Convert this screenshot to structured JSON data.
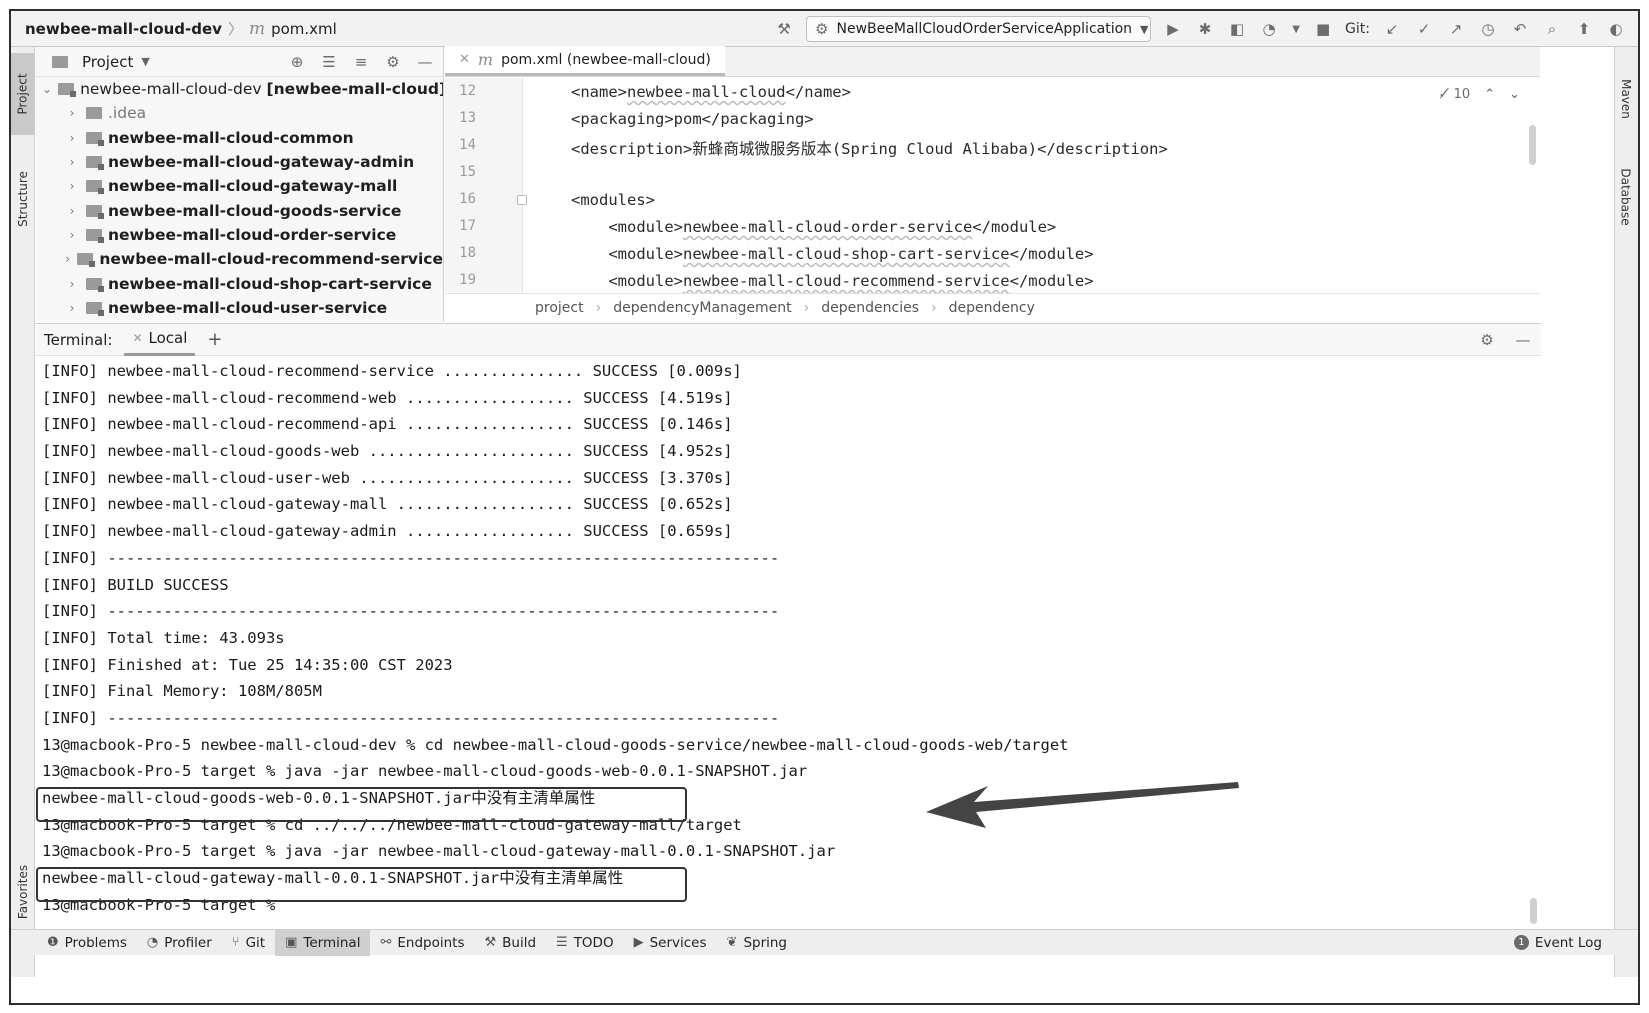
{
  "navbar": {
    "project": "newbee-mall-cloud-dev",
    "file": "pom.xml",
    "run_config": "NewBeeMallCloudOrderServiceApplication",
    "git_label": "Git:"
  },
  "left_strip": {
    "project_tab": "Project",
    "structure_tab": "Structure",
    "favorites_tab": "Favorites"
  },
  "right_strip": {
    "maven_tab": "Maven",
    "database_tab": "Database"
  },
  "project_panel": {
    "title": "Project",
    "root": {
      "name": "newbee-mall-cloud-dev",
      "module": "[newbee-mall-cloud]"
    },
    "items": [
      {
        "label": "newbee-mall-cloud-common"
      },
      {
        "label": "newbee-mall-cloud-gateway-admin"
      },
      {
        "label": "newbee-mall-cloud-gateway-mall"
      },
      {
        "label": "newbee-mall-cloud-goods-service"
      },
      {
        "label": "newbee-mall-cloud-order-service"
      },
      {
        "label": "newbee-mall-cloud-recommend-service"
      },
      {
        "label": "newbee-mall-cloud-shop-cart-service"
      },
      {
        "label": "newbee-mall-cloud-user-service"
      }
    ],
    "idea": ".idea"
  },
  "editor": {
    "tab": "pom.xml (newbee-mall-cloud)",
    "inspections": "10",
    "lines": [
      {
        "n": "12",
        "pre": "<name>",
        "val": "newbee-mall-cloud",
        "post": "</name>"
      },
      {
        "n": "13",
        "pre": "<packaging>",
        "val": "pom",
        "post": "</packaging>"
      },
      {
        "n": "14",
        "pre": "<description>",
        "val": "新蜂商城微服务版本(Spring Cloud Alibaba)",
        "post": "</description>"
      },
      {
        "n": "15",
        "pre": "",
        "val": "",
        "post": ""
      },
      {
        "n": "16",
        "pre": "<modules>",
        "val": "",
        "post": ""
      },
      {
        "n": "17",
        "pre": "    <module>",
        "val": "newbee-mall-cloud-order-service",
        "post": "</module>"
      },
      {
        "n": "18",
        "pre": "    <module>",
        "val": "newbee-mall-cloud-shop-cart-service",
        "post": "</module>"
      },
      {
        "n": "19",
        "pre": "    <module>",
        "val": "newbee-mall-cloud-recommend-service",
        "post": "</module>"
      }
    ],
    "breadcrumbs": [
      "project",
      "dependencyManagement",
      "dependencies",
      "dependency"
    ]
  },
  "terminal": {
    "title": "Terminal:",
    "tab": "Local",
    "lines": [
      "[INFO] newbee-mall-cloud-recommend-service ............... SUCCESS [0.009s]",
      "[INFO] newbee-mall-cloud-recommend-web .................. SUCCESS [4.519s]",
      "[INFO] newbee-mall-cloud-recommend-api .................. SUCCESS [0.146s]",
      "[INFO] newbee-mall-cloud-goods-web ...................... SUCCESS [4.952s]",
      "[INFO] newbee-mall-cloud-user-web ....................... SUCCESS [3.370s]",
      "[INFO] newbee-mall-cloud-gateway-mall ................... SUCCESS [0.652s]",
      "[INFO] newbee-mall-cloud-gateway-admin .................. SUCCESS [0.659s]",
      "[INFO] ------------------------------------------------------------------------",
      "[INFO] BUILD SUCCESS",
      "[INFO] ------------------------------------------------------------------------",
      "[INFO] Total time: 43.093s",
      "[INFO] Finished at: Tue 25 14:35:00 CST 2023",
      "[INFO] Final Memory: 108M/805M",
      "[INFO] ------------------------------------------------------------------------",
      "13@macbook-Pro-5 newbee-mall-cloud-dev % cd newbee-mall-cloud-goods-service/newbee-mall-cloud-goods-web/target",
      "13@macbook-Pro-5 target % java -jar newbee-mall-cloud-goods-web-0.0.1-SNAPSHOT.jar",
      "newbee-mall-cloud-goods-web-0.0.1-SNAPSHOT.jar中没有主清单属性",
      "13@macbook-Pro-5 target % cd ../../../newbee-mall-cloud-gateway-mall/target",
      "13@macbook-Pro-5 target % java -jar newbee-mall-cloud-gateway-mall-0.0.1-SNAPSHOT.jar",
      "newbee-mall-cloud-gateway-mall-0.0.1-SNAPSHOT.jar中没有主清单属性",
      "13@macbook-Pro-5 target %"
    ]
  },
  "bottom_bar": {
    "items": [
      "Problems",
      "Profiler",
      "Git",
      "Terminal",
      "Endpoints",
      "Build",
      "TODO",
      "Services",
      "Spring"
    ],
    "event_log": "Event Log",
    "event_count": "1"
  },
  "colors": {
    "annotation": "#333333",
    "active_tab": "#cfcfcf"
  }
}
